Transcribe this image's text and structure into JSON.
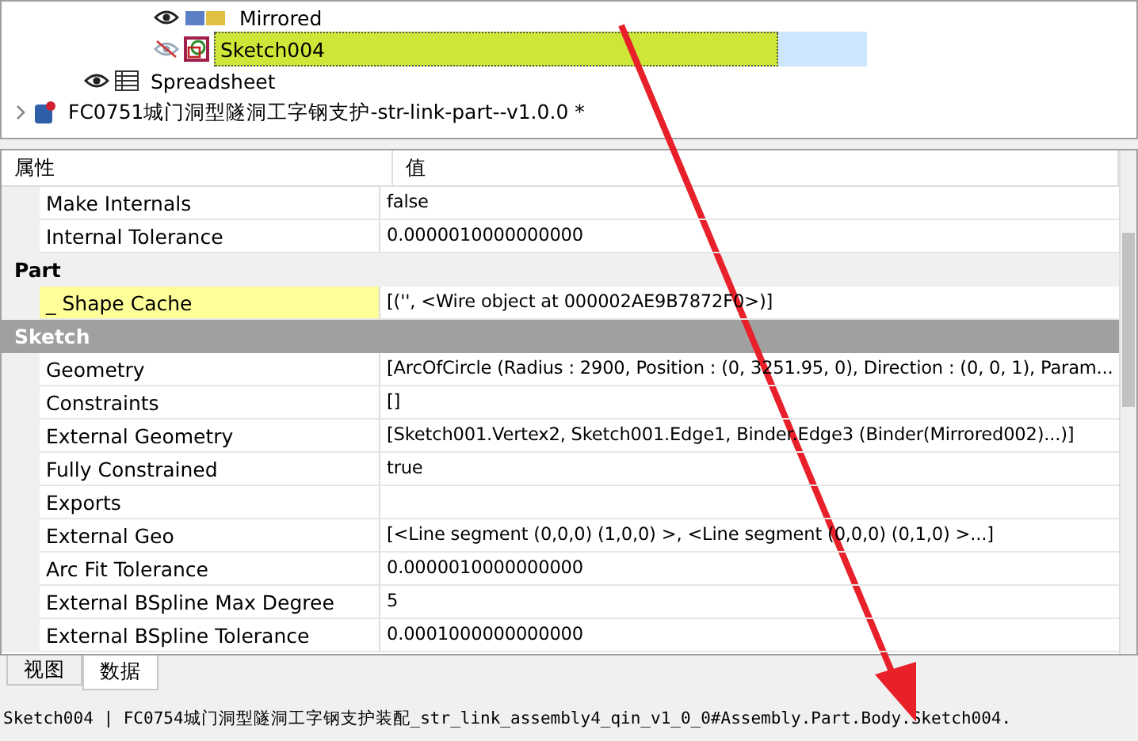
{
  "tree": {
    "items": [
      {
        "children": [
          {
            "children": [
              {
                "kind": "mirror",
                "label": "Mirrored",
                "visible": true,
                "selected": false
              },
              {
                "kind": "sketch",
                "label": "Sketch004",
                "visible": false,
                "selected": true
              }
            ]
          },
          {
            "kind": "spreadsheet",
            "label": "Spreadsheet",
            "visible": true,
            "selected": false
          }
        ]
      },
      {
        "kind": "part",
        "label": "FC0751城门洞型隧洞工字钢支护-str-link-part--v1.0.0 *",
        "selected": false
      }
    ]
  },
  "properties": {
    "columns": [
      "属性",
      "值"
    ],
    "rows": [
      {
        "kind": "property",
        "name": "Make Internals",
        "value": "false",
        "highlighted": false
      },
      {
        "kind": "property",
        "name": "Internal Tolerance",
        "value": "0.0000010000000000",
        "highlighted": false
      },
      {
        "kind": "group",
        "name": "Part"
      },
      {
        "kind": "property",
        "name": "_ Shape Cache",
        "value": "[('', <Wire object at 000002AE9B7872F0>)]",
        "highlighted": true
      },
      {
        "kind": "category",
        "name": "Sketch"
      },
      {
        "kind": "property",
        "name": "Geometry",
        "value": "[ArcOfCircle (Radius : 2900, Position : (0, 3251.95, 0), Direction : (0, 0, 1), Param...",
        "highlighted": false
      },
      {
        "kind": "property",
        "name": "Constraints",
        "value": "[]",
        "highlighted": false
      },
      {
        "kind": "property",
        "name": "External Geometry",
        "value": "[Sketch001.Vertex2, Sketch001.Edge1, Binder.Edge3 (Binder(Mirrored002)...)]",
        "highlighted": false
      },
      {
        "kind": "property",
        "name": "Fully Constrained",
        "value": "true",
        "highlighted": false
      },
      {
        "kind": "property",
        "name": "Exports",
        "value": "",
        "highlighted": false
      },
      {
        "kind": "property",
        "name": "External Geo",
        "value": "[<Line segment (0,0,0) (1,0,0) >, <Line segment (0,0,0) (0,1,0) >...]",
        "highlighted": false
      },
      {
        "kind": "property",
        "name": "Arc Fit Tolerance",
        "value": "0.0000010000000000",
        "highlighted": false
      },
      {
        "kind": "property",
        "name": "External BSpline Max Degree",
        "value": "5",
        "highlighted": false
      },
      {
        "kind": "property",
        "name": "External BSpline Tolerance",
        "value": "0.0001000000000000",
        "highlighted": false
      }
    ]
  },
  "tabs": [
    {
      "label": "视图",
      "selected": false
    },
    {
      "label": "数据",
      "selected": true
    }
  ],
  "status_bar": {
    "text": "Sketch004 | FC0754城门洞型隧洞工字钢支护装配_str_link_assembly4_qin_v1_0_0#Assembly.Part.Body.Sketch004."
  }
}
